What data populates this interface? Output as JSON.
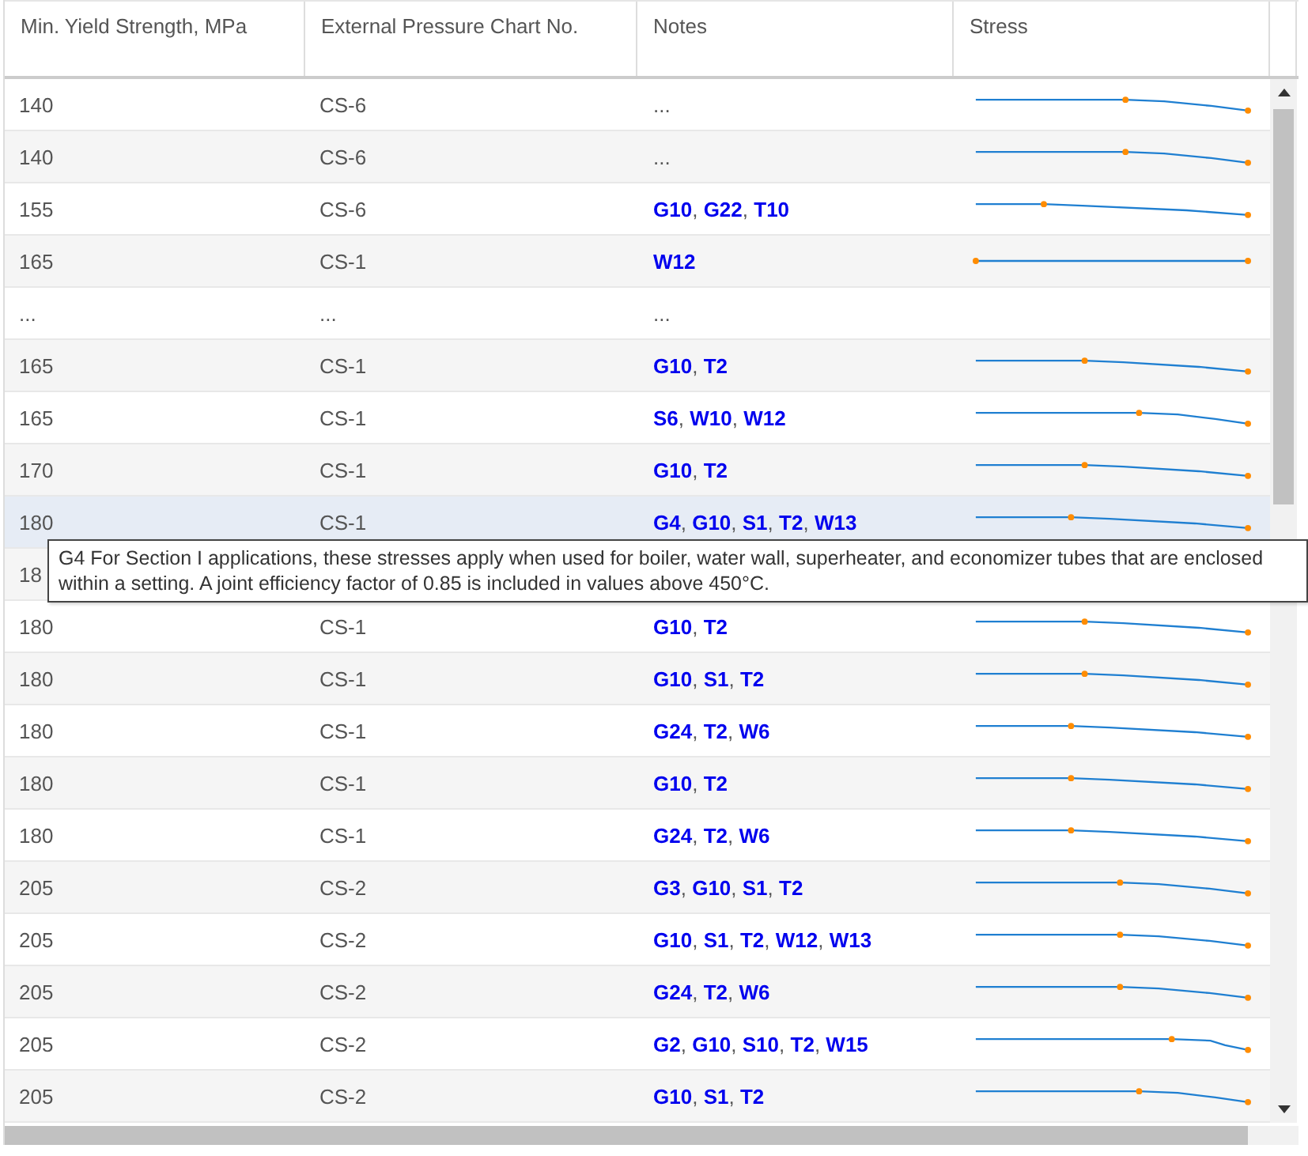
{
  "table": {
    "columns": [
      "Min. Yield Strength, MPa",
      "External Pressure Chart No.",
      "Notes",
      "Stress"
    ],
    "rows": [
      {
        "strength": "140",
        "chart": "CS-6",
        "notes_text": "...",
        "stress_chart": true,
        "hovered": false
      },
      {
        "strength": "140",
        "chart": "CS-6",
        "notes_text": "...",
        "stress_chart": true,
        "hovered": false
      },
      {
        "strength": "155",
        "chart": "CS-6",
        "notes": [
          {
            "code": "G10",
            "sep": ", "
          },
          {
            "code": "G22",
            "sep": ", "
          },
          {
            "code": "T10"
          }
        ],
        "stress_chart": true,
        "hovered": false
      },
      {
        "strength": "165",
        "chart": "CS-1",
        "notes": [
          {
            "code": "W12"
          }
        ],
        "stress_chart": true,
        "hovered": false
      },
      {
        "strength": "...",
        "chart": "...",
        "notes_text": "...",
        "stress_chart": false,
        "hovered": false
      },
      {
        "strength": "165",
        "chart": "CS-1",
        "notes": [
          {
            "code": "G10",
            "sep": ", "
          },
          {
            "code": "T2"
          }
        ],
        "stress_chart": true,
        "hovered": false
      },
      {
        "strength": "165",
        "chart": "CS-1",
        "notes": [
          {
            "code": "S6",
            "sep": ", "
          },
          {
            "code": "W10",
            "sep": ", "
          },
          {
            "code": "W12"
          }
        ],
        "stress_chart": true,
        "hovered": false
      },
      {
        "strength": "170",
        "chart": "CS-1",
        "notes": [
          {
            "code": "G10",
            "sep": ", "
          },
          {
            "code": "T2"
          }
        ],
        "stress_chart": true,
        "hovered": false
      },
      {
        "strength": "180",
        "chart": "CS-1",
        "notes": [
          {
            "code": "G4",
            "sep": ", "
          },
          {
            "code": "G10",
            "sep": ", "
          },
          {
            "code": "S1",
            "sep": ", "
          },
          {
            "code": "T2",
            "sep": ", "
          },
          {
            "code": "W13"
          }
        ],
        "stress_chart": true,
        "hovered": true
      },
      {
        "strength": "18",
        "hovered": false
      },
      {
        "strength": "180",
        "chart": "CS-1",
        "notes": [
          {
            "code": "G10",
            "sep": ", "
          },
          {
            "code": "T2"
          }
        ],
        "stress_chart": true,
        "hovered": false
      },
      {
        "strength": "180",
        "chart": "CS-1",
        "notes": [
          {
            "code": "G10",
            "sep": ", "
          },
          {
            "code": "S1",
            "sep": ", "
          },
          {
            "code": "T2"
          }
        ],
        "stress_chart": true,
        "hovered": false
      },
      {
        "strength": "180",
        "chart": "CS-1",
        "notes": [
          {
            "code": "G24",
            "sep": ", "
          },
          {
            "code": "T2",
            "sep": ", "
          },
          {
            "code": "W6"
          }
        ],
        "stress_chart": true,
        "hovered": false
      },
      {
        "strength": "180",
        "chart": "CS-1",
        "notes": [
          {
            "code": "G10",
            "sep": ", "
          },
          {
            "code": "T2"
          }
        ],
        "stress_chart": true,
        "hovered": false
      },
      {
        "strength": "180",
        "chart": "CS-1",
        "notes": [
          {
            "code": "G24",
            "sep": ", "
          },
          {
            "code": "T2",
            "sep": ", "
          },
          {
            "code": "W6"
          }
        ],
        "stress_chart": true,
        "hovered": false
      },
      {
        "strength": "205",
        "chart": "CS-2",
        "notes": [
          {
            "code": "G3",
            "sep": ", "
          },
          {
            "code": "G10",
            "sep": ", "
          },
          {
            "code": "S1",
            "sep": ", "
          },
          {
            "code": "T2"
          }
        ],
        "stress_chart": true,
        "hovered": false
      },
      {
        "strength": "205",
        "chart": "CS-2",
        "notes": [
          {
            "code": "G10",
            "sep": ", "
          },
          {
            "code": "S1",
            "sep": ", "
          },
          {
            "code": "T2",
            "sep": ", "
          },
          {
            "code": "W12",
            "sep": ", "
          },
          {
            "code": "W13"
          }
        ],
        "stress_chart": true,
        "hovered": false
      },
      {
        "strength": "205",
        "chart": "CS-2",
        "notes": [
          {
            "code": "G24",
            "sep": ", "
          },
          {
            "code": "T2",
            "sep": ", "
          },
          {
            "code": "W6"
          }
        ],
        "stress_chart": true,
        "hovered": false
      },
      {
        "strength": "205",
        "chart": "CS-2",
        "notes": [
          {
            "code": "G2",
            "sep": ", "
          },
          {
            "code": "G10",
            "sep": ", "
          },
          {
            "code": "S10",
            "sep": ", "
          },
          {
            "code": "T2",
            "sep": ", "
          },
          {
            "code": "W15"
          }
        ],
        "stress_chart": true,
        "hovered": false
      },
      {
        "strength": "205",
        "chart": "CS-2",
        "notes": [
          {
            "code": "G10",
            "sep": ", "
          },
          {
            "code": "S1",
            "sep": ", "
          },
          {
            "code": "T2"
          }
        ],
        "stress_chart": true,
        "hovered": false
      }
    ]
  },
  "tooltip": {
    "text": "G4 For Section I applications, these stresses apply when used for boiler, water wall, superheater, and economizer tubes that are enclosed within a setting. A joint efficiency factor of 0.85 is included in values above 450°C."
  }
}
